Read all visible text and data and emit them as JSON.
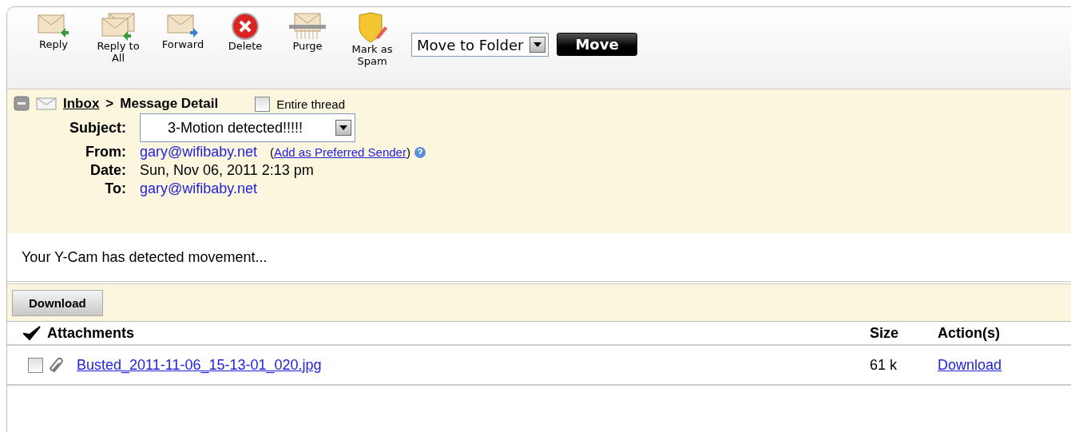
{
  "toolbar": {
    "buttons": [
      {
        "kind": "reply",
        "label": "Reply"
      },
      {
        "kind": "reply_all",
        "label": "Reply to All"
      },
      {
        "kind": "forward",
        "label": "Forward"
      },
      {
        "kind": "delete",
        "label": "Delete"
      },
      {
        "kind": "purge",
        "label": "Purge"
      },
      {
        "kind": "spam",
        "label": "Mark as Spam"
      }
    ],
    "folder_select": {
      "value": "Move to Folder"
    },
    "move_button": "Move"
  },
  "header": {
    "breadcrumb": {
      "link": "Inbox",
      "separator": ">",
      "current": "Message Detail"
    },
    "entire_thread": {
      "label": "Entire thread",
      "checked": false
    },
    "fields": [
      {
        "kind": "select",
        "label": "Subject:",
        "value": "3-Motion detected!!!!!"
      },
      {
        "kind": "email",
        "label": "From:",
        "value": "gary@wifibaby.net",
        "extra": {
          "open": "(",
          "link": "Add as Preferred Sender",
          "close": ")"
        }
      },
      {
        "kind": "text",
        "label": "Date:",
        "value": "Sun, Nov 06, 2011 2:13 pm"
      },
      {
        "kind": "email",
        "label": "To:",
        "value": "gary@wifibaby.net"
      }
    ]
  },
  "body": "Your Y-Cam has detected movement...",
  "download_button": "Download",
  "attachments": {
    "columns": [
      "Attachments",
      "Size",
      "Action(s)"
    ],
    "rows": [
      {
        "name": "Busted_2011-11-06_15-13-01_020.jpg",
        "size": "61 k",
        "action": "Download",
        "checked": false
      }
    ]
  }
}
